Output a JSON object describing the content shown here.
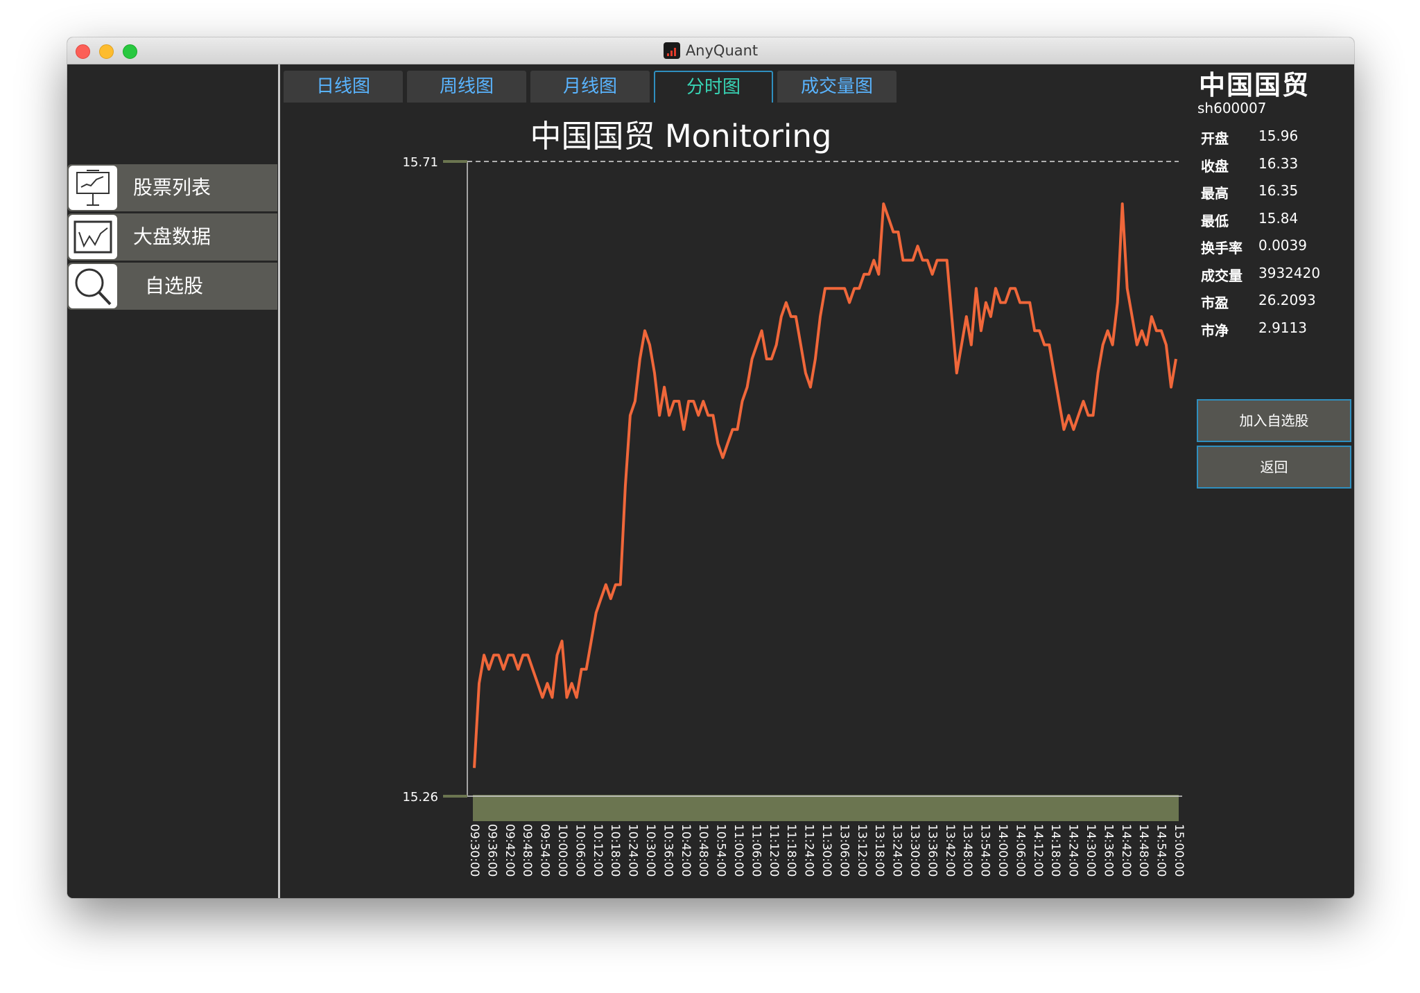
{
  "window": {
    "title": "AnyQuant"
  },
  "sidebar": {
    "items": [
      {
        "label": "股票列表",
        "icon": "presentation-chart-icon"
      },
      {
        "label": "大盘数据",
        "icon": "line-chart-icon"
      },
      {
        "label": "自选股",
        "icon": "search-icon"
      }
    ]
  },
  "tabs": [
    {
      "label": "日线图",
      "active": false
    },
    {
      "label": "周线图",
      "active": false
    },
    {
      "label": "月线图",
      "active": false
    },
    {
      "label": "分时图",
      "active": true
    },
    {
      "label": "成交量图",
      "active": false
    }
  ],
  "stock": {
    "name": "中国国贸",
    "code": "sh600007",
    "fields": [
      {
        "label": "开盘",
        "value": "15.96"
      },
      {
        "label": "收盘",
        "value": "16.33"
      },
      {
        "label": "最高",
        "value": "16.35"
      },
      {
        "label": "最低",
        "value": "15.84"
      },
      {
        "label": "换手率",
        "value": "0.0039"
      },
      {
        "label": "成交量",
        "value": "3932420"
      },
      {
        "label": "市盈",
        "value": "26.2093"
      },
      {
        "label": "市净",
        "value": "2.9113"
      }
    ]
  },
  "actions": {
    "add_watchlist": "加入自选股",
    "back": "返回"
  },
  "colors": {
    "line": "#f0673a",
    "axis_band": "#6b7550",
    "active_tab": "#38d4b5",
    "tab_text": "#59b4ff"
  },
  "chart_data": {
    "type": "line",
    "title": "中国国贸 Monitoring",
    "y_tick_labels": [
      "15.71",
      "15.26"
    ],
    "x_tick_labels": [
      "09:30:00",
      "09:36:00",
      "09:42:00",
      "09:48:00",
      "09:54:00",
      "10:00:00",
      "10:06:00",
      "10:12:00",
      "10:18:00",
      "10:24:00",
      "10:30:00",
      "10:36:00",
      "10:42:00",
      "10:48:00",
      "10:54:00",
      "11:00:00",
      "11:06:00",
      "11:12:00",
      "11:18:00",
      "11:24:00",
      "11:30:00",
      "13:06:00",
      "13:12:00",
      "13:18:00",
      "13:24:00",
      "13:30:00",
      "13:36:00",
      "13:42:00",
      "13:48:00",
      "13:54:00",
      "14:00:00",
      "14:06:00",
      "14:12:00",
      "14:18:00",
      "14:24:00",
      "14:30:00",
      "14:36:00",
      "14:42:00",
      "14:48:00",
      "14:54:00",
      "15:00:00"
    ],
    "series": [
      {
        "values": [
          15.28,
          15.34,
          15.36,
          15.35,
          15.36,
          15.36,
          15.35,
          15.36,
          15.36,
          15.35,
          15.36,
          15.36,
          15.35,
          15.34,
          15.33,
          15.34,
          15.33,
          15.36,
          15.37,
          15.33,
          15.34,
          15.33,
          15.35,
          15.35,
          15.37,
          15.39,
          15.4,
          15.41,
          15.4,
          15.41,
          15.41,
          15.48,
          15.53,
          15.54,
          15.57,
          15.59,
          15.58,
          15.56,
          15.53,
          15.55,
          15.53,
          15.54,
          15.54,
          15.52,
          15.54,
          15.54,
          15.53,
          15.54,
          15.53,
          15.53,
          15.51,
          15.5,
          15.51,
          15.52,
          15.52,
          15.54,
          15.55,
          15.57,
          15.58,
          15.59,
          15.57,
          15.57,
          15.58,
          15.6,
          15.61,
          15.6,
          15.6,
          15.58,
          15.56,
          15.55,
          15.57,
          15.6,
          15.62,
          15.62,
          15.62,
          15.62,
          15.62,
          15.61,
          15.62,
          15.62,
          15.63,
          15.63,
          15.64,
          15.63,
          15.68,
          15.67,
          15.66,
          15.66,
          15.64,
          15.64,
          15.64,
          15.65,
          15.64,
          15.64,
          15.63,
          15.64,
          15.64,
          15.64,
          15.6,
          15.56,
          15.58,
          15.6,
          15.58,
          15.62,
          15.59,
          15.61,
          15.6,
          15.62,
          15.61,
          15.61,
          15.62,
          15.62,
          15.61,
          15.61,
          15.61,
          15.59,
          15.59,
          15.58,
          15.58,
          15.56,
          15.54,
          15.52,
          15.53,
          15.52,
          15.53,
          15.54,
          15.53,
          15.53,
          15.56,
          15.58,
          15.59,
          15.58,
          15.61,
          15.68,
          15.62,
          15.6,
          15.58,
          15.59,
          15.58,
          15.6,
          15.59,
          15.59,
          15.58,
          15.55,
          15.57
        ]
      }
    ]
  }
}
